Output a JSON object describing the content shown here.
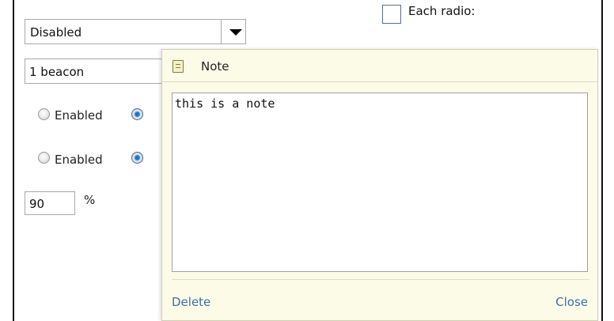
{
  "form": {
    "select_value": "Disabled",
    "checkbox_label": "Each radio:",
    "beacon_value": "1 beacon",
    "radio_rows": [
      {
        "label": "Enabled"
      },
      {
        "label": "Enabled"
      }
    ],
    "percent_value": "90",
    "percent_sign": "%"
  },
  "note": {
    "title": "Note",
    "text": "this is a note",
    "delete_label": "Delete",
    "close_label": "Close"
  },
  "icons": {
    "note": "note-icon",
    "dropdown": "chevron-down-icon"
  },
  "colors": {
    "note_bg": "#fbfbe8",
    "link": "#3e6faf",
    "radio_selected": "#1e6fbf"
  }
}
